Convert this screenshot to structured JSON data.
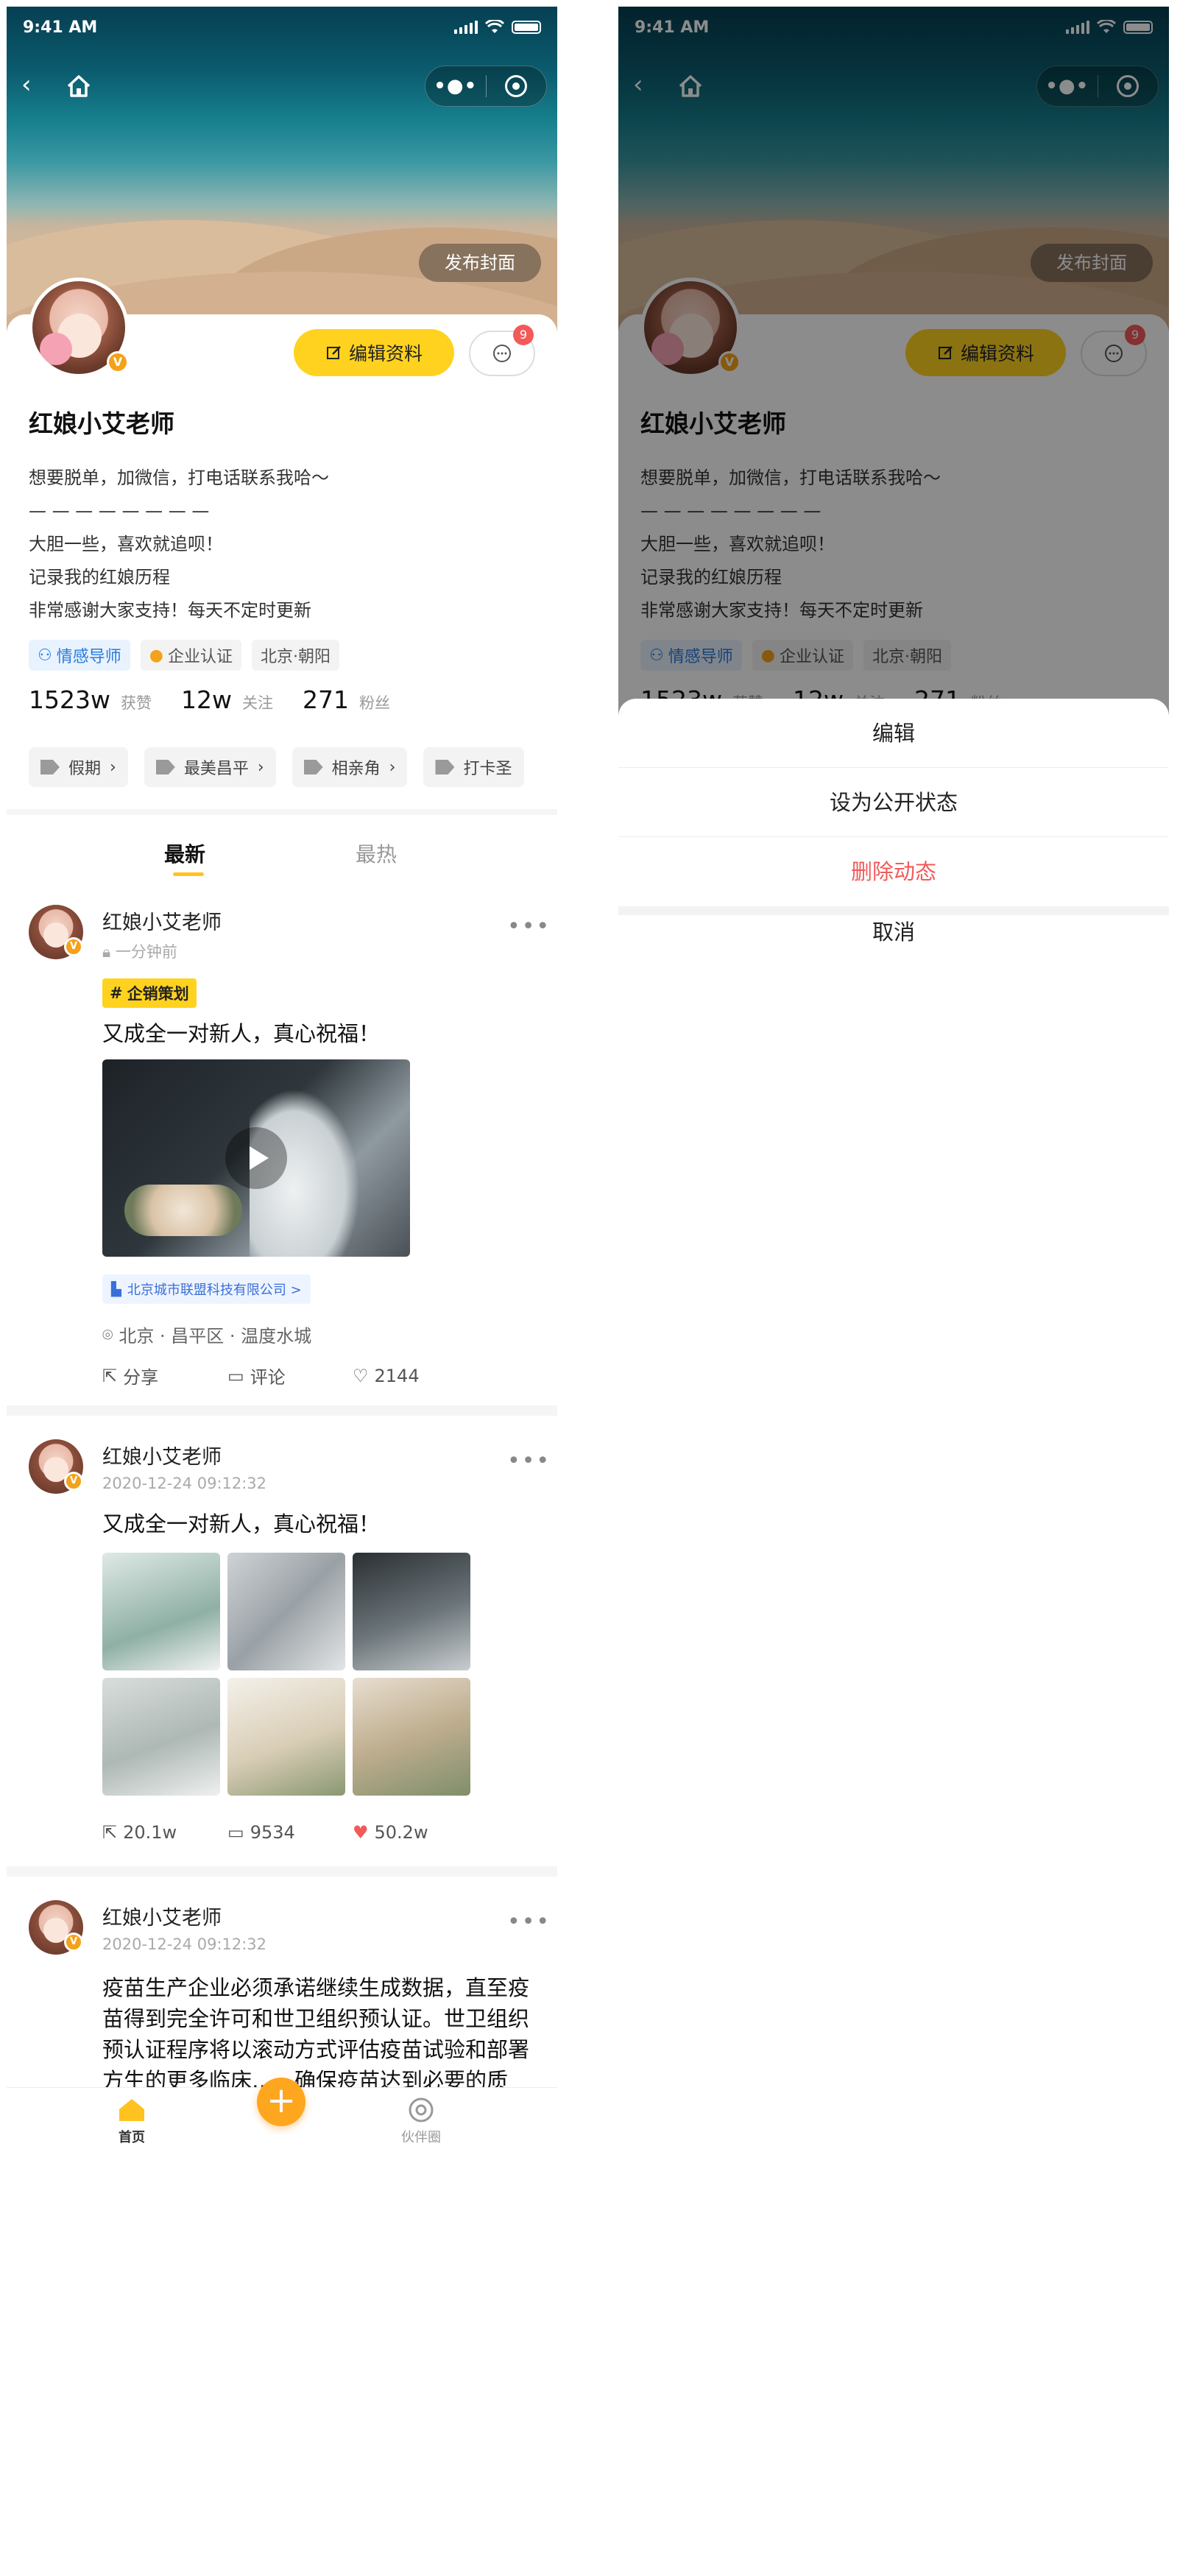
{
  "status": {
    "time": "9:41 AM"
  },
  "nav": {
    "back_icon": "‹",
    "more": "•●•"
  },
  "cover": {
    "button": "发布封面"
  },
  "profile": {
    "verified_mark": "V",
    "edit_button": "编辑资料",
    "message_count": "9",
    "name": "红娘小艾老师",
    "bio": [
      "想要脱单，加微信，打电话联系我哈～",
      "— — — — — — — —",
      "大胆一些，喜欢就追呗！",
      "记录我的红娘历程",
      "非常感谢大家支持！每天不定时更新"
    ],
    "tags": [
      "情感导师",
      "企业认证",
      "北京·朝阳"
    ],
    "stats": [
      {
        "num": "1523w",
        "label": "获赞"
      },
      {
        "num": "12w",
        "label": "关注"
      },
      {
        "num": "271",
        "label": "粉丝"
      }
    ],
    "topics": [
      "假期",
      "最美昌平",
      "相亲角",
      "打卡圣"
    ]
  },
  "tabs": [
    "最新",
    "最热"
  ],
  "posts": [
    {
      "name": "红娘小艾老师",
      "time": "一分钟前",
      "chip": "企销策划",
      "text": "又成全一对新人，真心祝福！",
      "company": "北京城市联盟科技有限公司 >",
      "location": "北京 · 昌平区 · 温度水城",
      "share": "分享",
      "comment": "评论",
      "like": "2144"
    },
    {
      "name": "红娘小艾老师",
      "time": "2020-12-24  09:12:32",
      "text": "又成全一对新人，真心祝福！",
      "share": "20.1w",
      "comment": "9534",
      "like": "50.2w"
    },
    {
      "name": "红娘小艾老师",
      "time": "2020-12-24  09:12:32",
      "text_lines": [
        "疫苗生产企业必须承诺继续生成数据，直至疫",
        "苗得到完全许可和世卫组织预认证。世卫组织",
        "预认证程序将以滚动方式评估疫苗试验和部署",
        "方生的更多临床…，确保疫苗达到必要的质"
      ]
    }
  ],
  "tabbar": {
    "home": "首页",
    "plus": "+",
    "partner": "伙伴圈"
  },
  "sheet": {
    "edit": "编辑",
    "public": "设为公开状态",
    "delete": "删除动态",
    "cancel": "取消"
  },
  "colors": {
    "accent": "#ffd21f",
    "danger": "#f25a5a",
    "link": "#2a7bd9"
  }
}
